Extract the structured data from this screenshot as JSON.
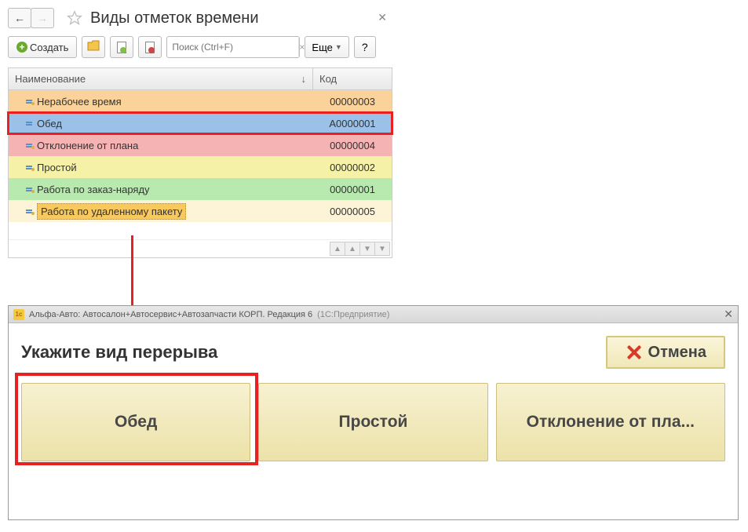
{
  "win1": {
    "title": "Виды отметок времени",
    "toolbar": {
      "create_label": "Создать",
      "search_placeholder": "Поиск (Ctrl+F)",
      "more_label": "Еще",
      "help_label": "?"
    },
    "grid": {
      "col_name": "Наименование",
      "col_code": "Код",
      "rows": [
        {
          "name": "Нерабочее время",
          "code": "00000003"
        },
        {
          "name": "Обед",
          "code": "A0000001"
        },
        {
          "name": "Отклонение от плана",
          "code": "00000004"
        },
        {
          "name": "Простой",
          "code": "00000002"
        },
        {
          "name": "Работа по заказ-наряду",
          "code": "00000001"
        },
        {
          "name": "Работа по удаленному пакету",
          "code": "00000005"
        }
      ]
    }
  },
  "win2": {
    "title_app": "Альфа-Авто: Автосалон+Автосервис+Автозапчасти КОРП. Редакция 6",
    "title_platform": "(1С:Предприятие)",
    "heading": "Укажите вид перерыва",
    "cancel_label": "Отмена",
    "choices": [
      "Обед",
      "Простой",
      "Отклонение от пла..."
    ]
  }
}
